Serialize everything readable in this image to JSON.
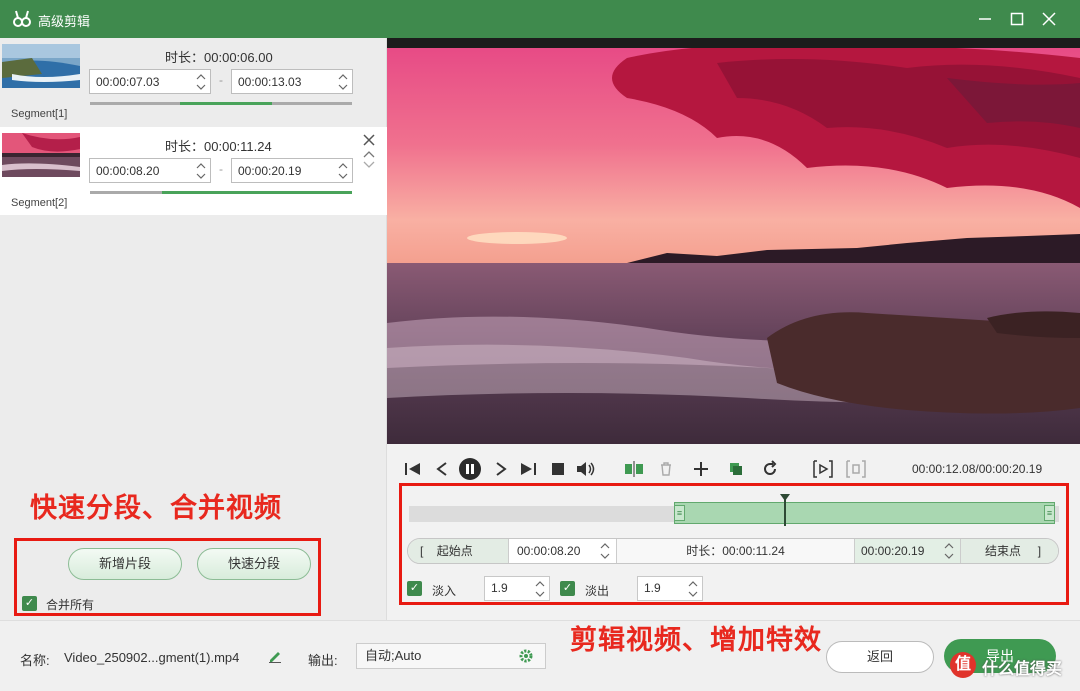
{
  "window": {
    "title": "高级剪辑",
    "accent": "#3f8a4d"
  },
  "segments": [
    {
      "label": "Segment[1]",
      "duration_label": "时长：",
      "duration": "00:00:06.00",
      "start": "00:00:07.03",
      "end": "00:00:13.03",
      "dash": "-",
      "progress": 0.35
    },
    {
      "label": "Segment[2]",
      "duration_label": "时长：",
      "duration": "00:00:11.24",
      "start": "00:00:08.20",
      "end": "00:00:20.19",
      "dash": "-",
      "progress": 0.58
    }
  ],
  "left_actions": {
    "add_segment": "新增片段",
    "quick_split": "快速分段",
    "merge_all": "合并所有",
    "merge_all_checked": true
  },
  "annotations": {
    "left": "快速分段、合并视频",
    "right": "剪辑视频、增加特效"
  },
  "player": {
    "timecode": "00:00:12.08/00:00:20.19",
    "playhead_fraction": 0.59
  },
  "range": {
    "start_btn": "起始点",
    "start_time": "00:00:08.20",
    "duration_label": "时长：",
    "duration": "00:00:11.24",
    "end_time": "00:00:20.19",
    "end_btn": "结束点",
    "open_bracket": "[",
    "close_bracket": "]"
  },
  "effects": {
    "fade_in_label": "淡入",
    "fade_in_value": "1.9",
    "fade_in_checked": true,
    "fade_out_label": "淡出",
    "fade_out_value": "1.9",
    "fade_out_checked": true
  },
  "bottom": {
    "name_label": "名称:",
    "file_name": "Video_250902...gment(1).mp4",
    "output_label": "输出:",
    "output_value": "自动;Auto",
    "back_button": "返回",
    "export_button": "导出"
  },
  "watermark": {
    "badge": "值",
    "text": "什么值得买"
  }
}
